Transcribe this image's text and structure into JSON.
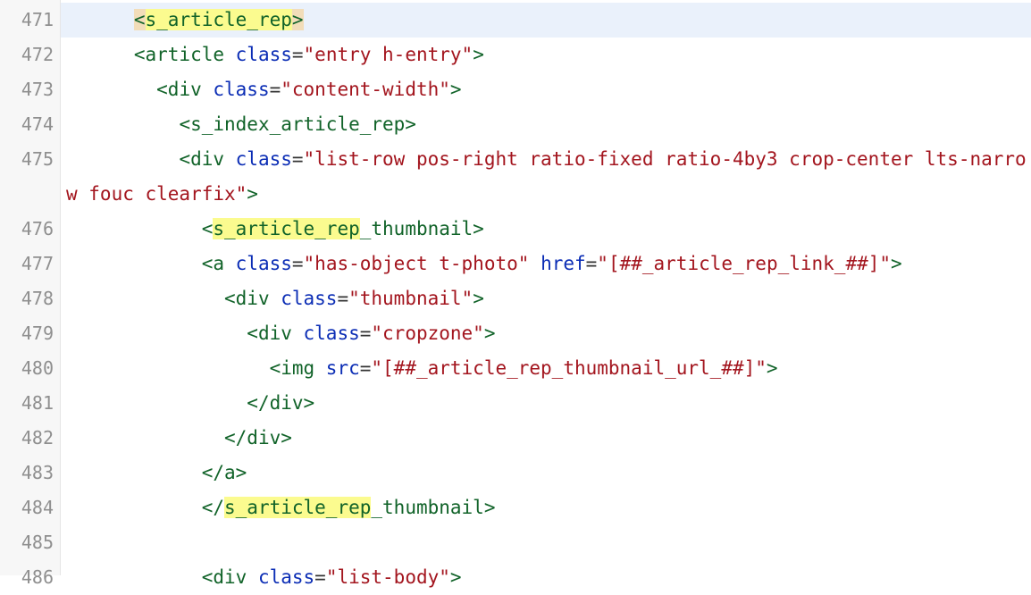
{
  "lines": [
    {
      "num": "471",
      "active": true,
      "indent": "      ",
      "parts": [
        {
          "text": "<",
          "cls": "t hl2"
        },
        {
          "text": "s_article_rep",
          "cls": "t hl"
        },
        {
          "text": ">",
          "cls": "t hl2"
        }
      ]
    },
    {
      "num": "472",
      "indent": "      ",
      "parts": [
        {
          "text": "<article ",
          "cls": "t"
        },
        {
          "text": "class",
          "cls": "a"
        },
        {
          "text": "=",
          "cls": "p"
        },
        {
          "text": "\"entry h-entry\"",
          "cls": "s"
        },
        {
          "text": ">",
          "cls": "t"
        }
      ]
    },
    {
      "num": "473",
      "indent": "        ",
      "parts": [
        {
          "text": "<div ",
          "cls": "t"
        },
        {
          "text": "class",
          "cls": "a"
        },
        {
          "text": "=",
          "cls": "p"
        },
        {
          "text": "\"content-width\"",
          "cls": "s"
        },
        {
          "text": ">",
          "cls": "t"
        }
      ]
    },
    {
      "num": "474",
      "indent": "          ",
      "parts": [
        {
          "text": "<s_index_article_rep>",
          "cls": "t"
        }
      ]
    },
    {
      "num": "475",
      "indent": "          ",
      "wrap": true,
      "parts": [
        {
          "text": "<div ",
          "cls": "t"
        },
        {
          "text": "class",
          "cls": "a"
        },
        {
          "text": "=",
          "cls": "p"
        },
        {
          "text": "\"list-row pos-right ratio-fixed ratio-4by3 crop-center lts-narrow fouc clearfix\"",
          "cls": "s"
        },
        {
          "text": ">",
          "cls": "t"
        }
      ]
    },
    {
      "num": "476",
      "indent": "            ",
      "parts": [
        {
          "text": "<",
          "cls": "t"
        },
        {
          "text": "s_article_rep",
          "cls": "t hl"
        },
        {
          "text": "_thumbnail>",
          "cls": "t"
        }
      ]
    },
    {
      "num": "477",
      "indent": "            ",
      "parts": [
        {
          "text": "<a ",
          "cls": "t"
        },
        {
          "text": "class",
          "cls": "a"
        },
        {
          "text": "=",
          "cls": "p"
        },
        {
          "text": "\"has-object t-photo\"",
          "cls": "s"
        },
        {
          "text": " ",
          "cls": "p"
        },
        {
          "text": "href",
          "cls": "a"
        },
        {
          "text": "=",
          "cls": "p"
        },
        {
          "text": "\"[##_article_rep_link_##]\"",
          "cls": "s"
        },
        {
          "text": ">",
          "cls": "t"
        }
      ]
    },
    {
      "num": "478",
      "indent": "              ",
      "parts": [
        {
          "text": "<div ",
          "cls": "t"
        },
        {
          "text": "class",
          "cls": "a"
        },
        {
          "text": "=",
          "cls": "p"
        },
        {
          "text": "\"thumbnail\"",
          "cls": "s"
        },
        {
          "text": ">",
          "cls": "t"
        }
      ]
    },
    {
      "num": "479",
      "indent": "                ",
      "parts": [
        {
          "text": "<div ",
          "cls": "t"
        },
        {
          "text": "class",
          "cls": "a"
        },
        {
          "text": "=",
          "cls": "p"
        },
        {
          "text": "\"cropzone\"",
          "cls": "s"
        },
        {
          "text": ">",
          "cls": "t"
        }
      ]
    },
    {
      "num": "480",
      "indent": "                  ",
      "parts": [
        {
          "text": "<img ",
          "cls": "t"
        },
        {
          "text": "src",
          "cls": "a"
        },
        {
          "text": "=",
          "cls": "p"
        },
        {
          "text": "\"[##_article_rep_thumbnail_url_##]\"",
          "cls": "s"
        },
        {
          "text": ">",
          "cls": "t"
        }
      ]
    },
    {
      "num": "481",
      "indent": "                ",
      "parts": [
        {
          "text": "</div>",
          "cls": "t"
        }
      ]
    },
    {
      "num": "482",
      "indent": "              ",
      "parts": [
        {
          "text": "</div>",
          "cls": "t"
        }
      ]
    },
    {
      "num": "483",
      "indent": "            ",
      "parts": [
        {
          "text": "</a>",
          "cls": "t"
        }
      ]
    },
    {
      "num": "484",
      "indent": "            ",
      "parts": [
        {
          "text": "</",
          "cls": "t"
        },
        {
          "text": "s_article_rep",
          "cls": "t hl"
        },
        {
          "text": "_thumbnail>",
          "cls": "t"
        }
      ]
    },
    {
      "num": "485",
      "indent": "",
      "parts": []
    },
    {
      "num": "486",
      "indent": "            ",
      "parts": [
        {
          "text": "<div ",
          "cls": "t"
        },
        {
          "text": "class",
          "cls": "a"
        },
        {
          "text": "=",
          "cls": "p"
        },
        {
          "text": "\"list-body\"",
          "cls": "s"
        },
        {
          "text": ">",
          "cls": "t"
        }
      ]
    }
  ],
  "colors": {
    "tag": "#116329",
    "attr": "#0b2db5",
    "string": "#a3151e",
    "match_highlight": "#fbfb8f",
    "active_line": "#eaf1fb",
    "gutter_number": "#8f8f8f"
  }
}
